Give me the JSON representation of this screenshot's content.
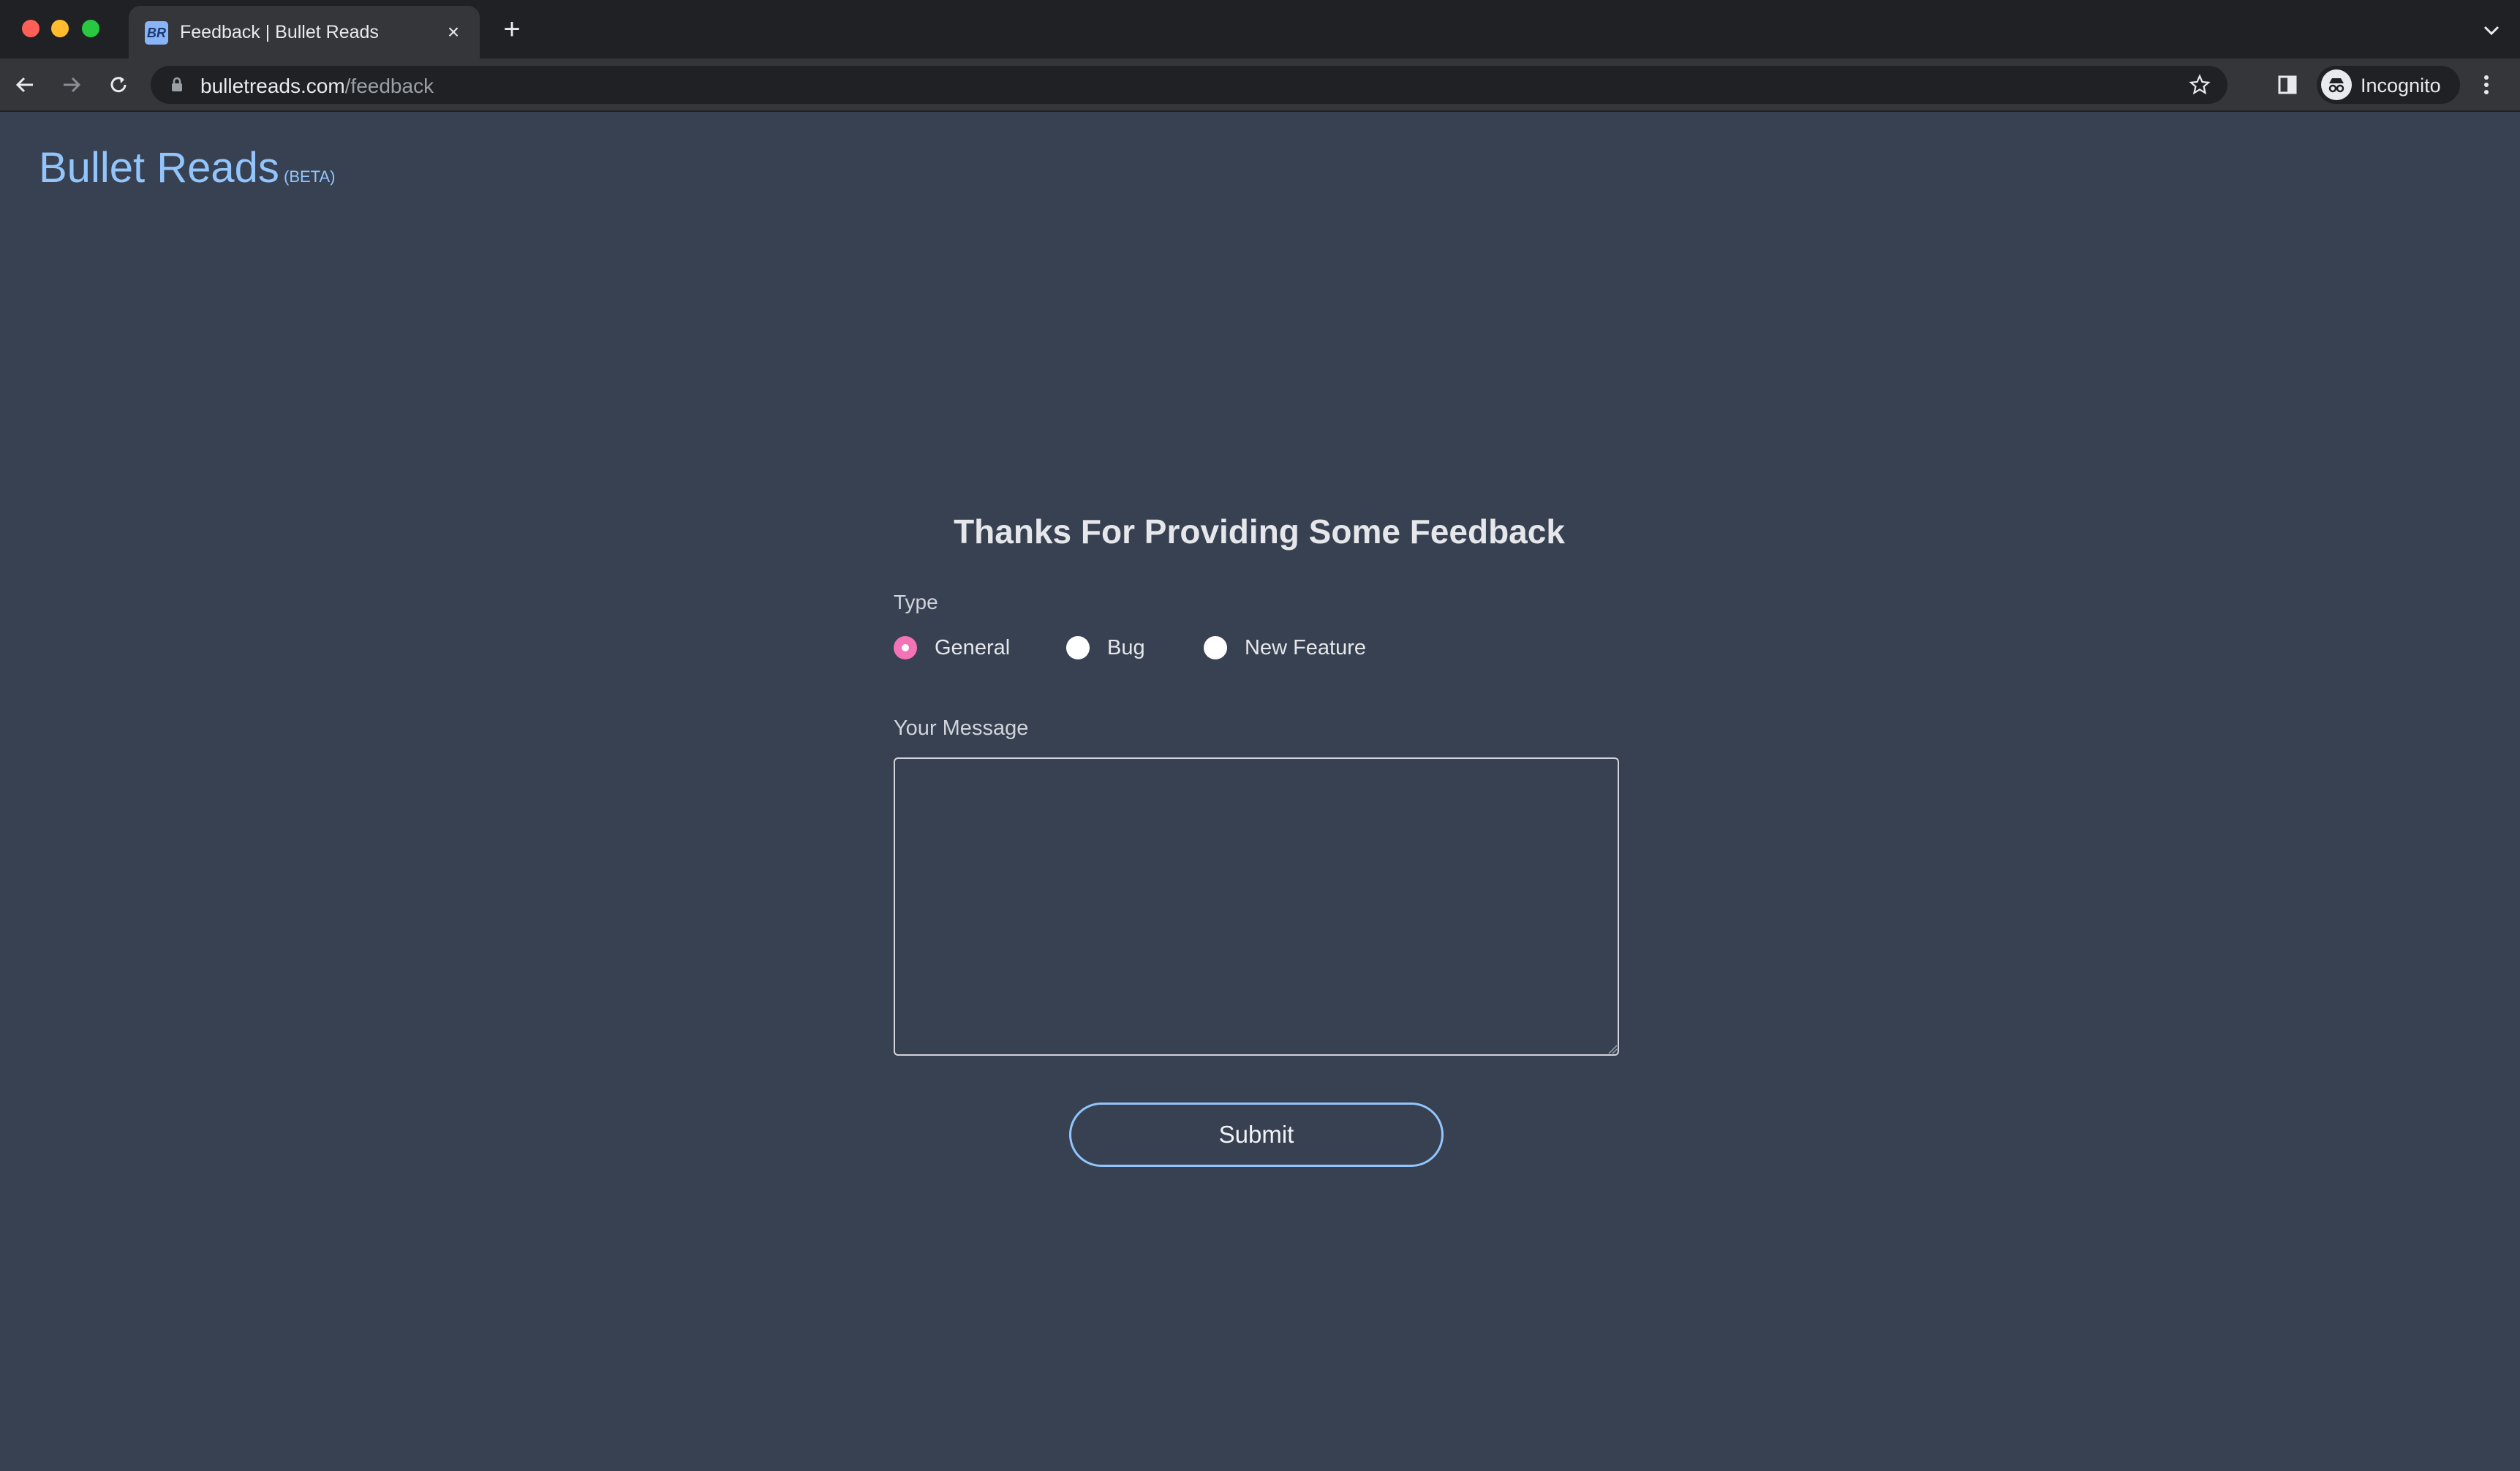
{
  "browser": {
    "tab_title": "Feedback | Bullet Reads",
    "tab_favicon_text": "BR",
    "url_domain": "bulletreads.com",
    "url_path": "/feedback",
    "profile_label": "Incognito",
    "icons": [
      "back-arrow-icon",
      "forward-arrow-icon",
      "reload-icon",
      "lock-icon",
      "star-icon",
      "side-panel-icon",
      "incognito-icon",
      "kebab-menu-icon",
      "new-tab-icon",
      "close-icon",
      "tab-search-chevron-icon"
    ]
  },
  "site": {
    "name": "Bullet Reads",
    "badge": "(BETA)"
  },
  "form": {
    "heading": "Thanks For Providing Some Feedback",
    "type_label": "Type",
    "types": [
      {
        "label": "General",
        "checked": true
      },
      {
        "label": "Bug",
        "checked": false
      },
      {
        "label": "New Feature",
        "checked": false
      }
    ],
    "message_label": "Your Message",
    "message_value": "",
    "submit_label": "Submit"
  },
  "colors": {
    "page_bg": "#374151",
    "logo": "#93c5fd",
    "radio_checked": "#f472b6",
    "submit_border": "#93c5fd"
  }
}
